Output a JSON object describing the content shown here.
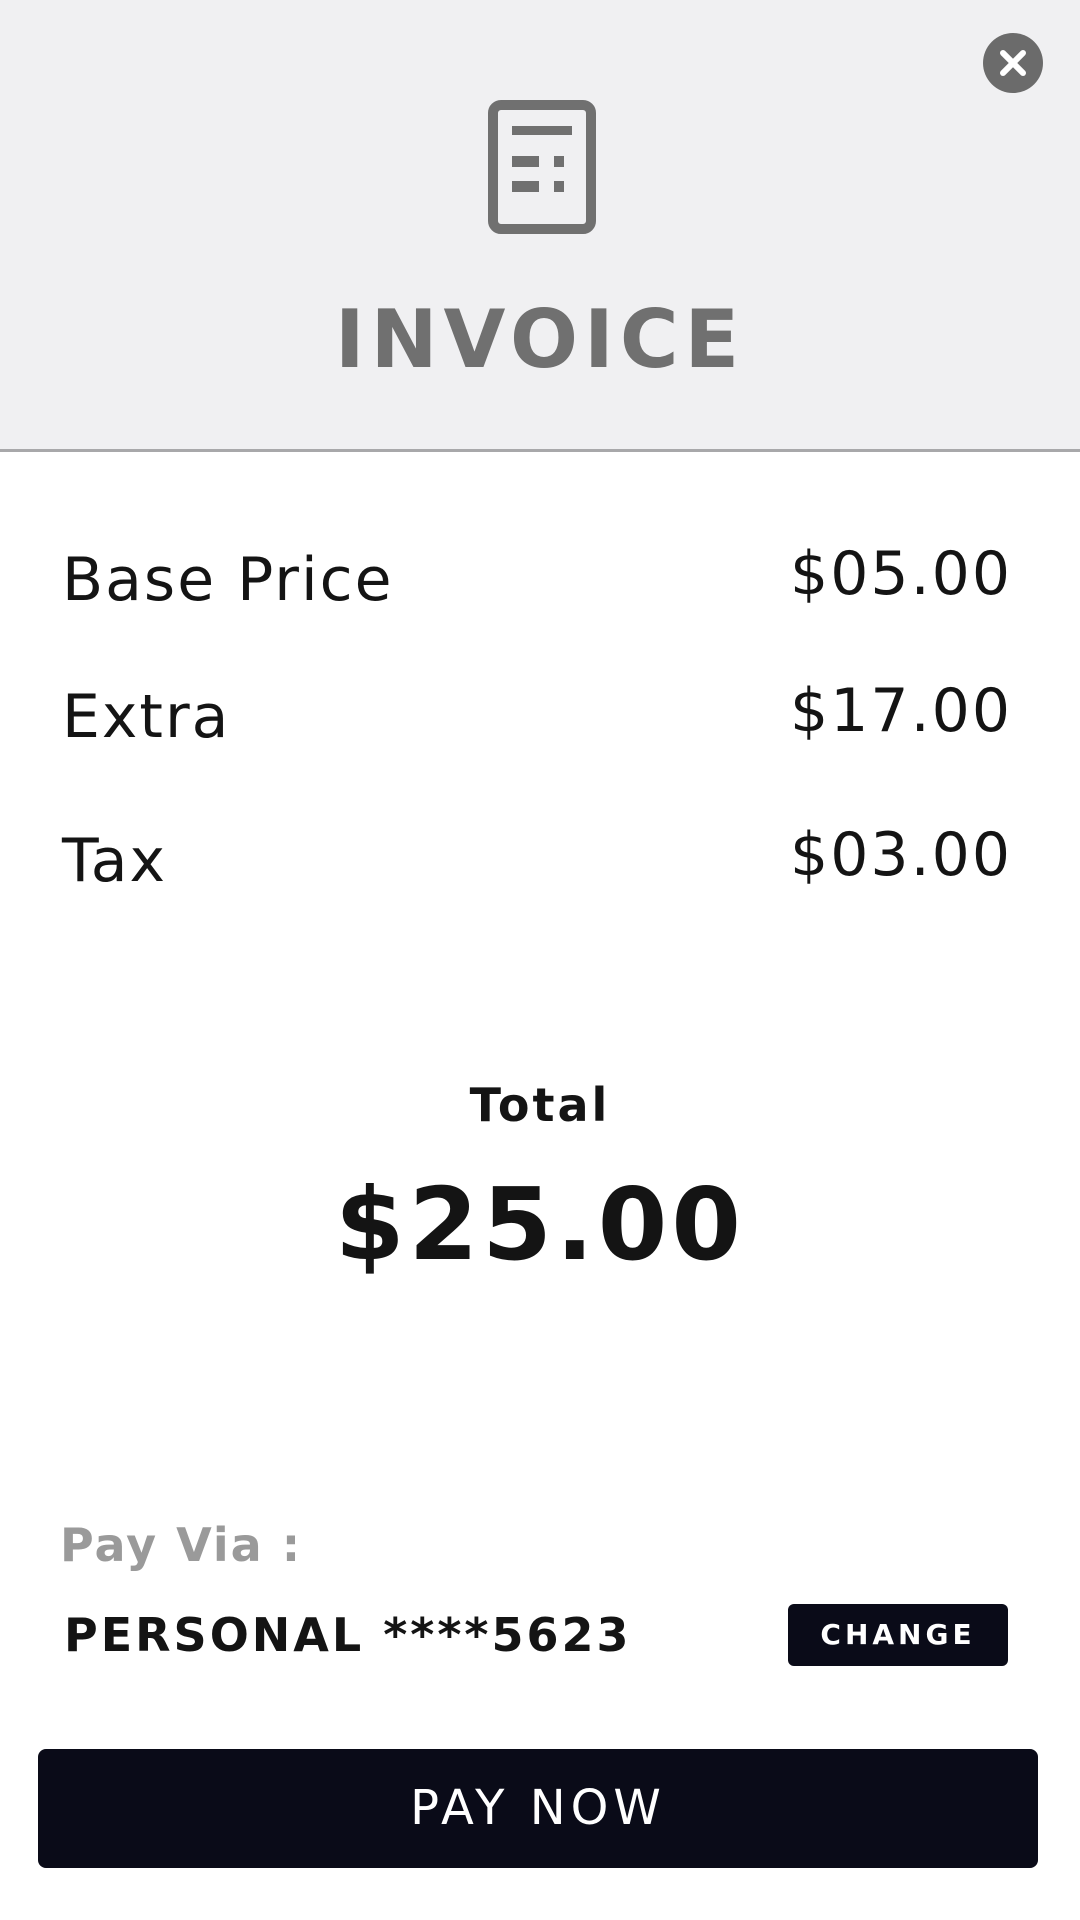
{
  "header": {
    "title": "INVOICE",
    "icon": "calculator-icon",
    "close_icon": "close-icon"
  },
  "line_items": [
    {
      "label": "Base Price",
      "value": "$05.00"
    },
    {
      "label": "Extra",
      "value": "$17.00"
    },
    {
      "label": "Tax",
      "value": "$03.00"
    }
  ],
  "total": {
    "label": "Total",
    "value": "$25.00"
  },
  "payment": {
    "pay_via_label": "Pay Via :",
    "method": "PERSONAL ****5623",
    "change_label": "CHANGE"
  },
  "actions": {
    "pay_now_label": "PAY NOW"
  },
  "colors": {
    "header_bg": "#f0f0f2",
    "icon_grey": "#707070",
    "button_dark": "#0a0b18",
    "text_dark": "#141414",
    "muted_text": "#9a9a9a"
  }
}
